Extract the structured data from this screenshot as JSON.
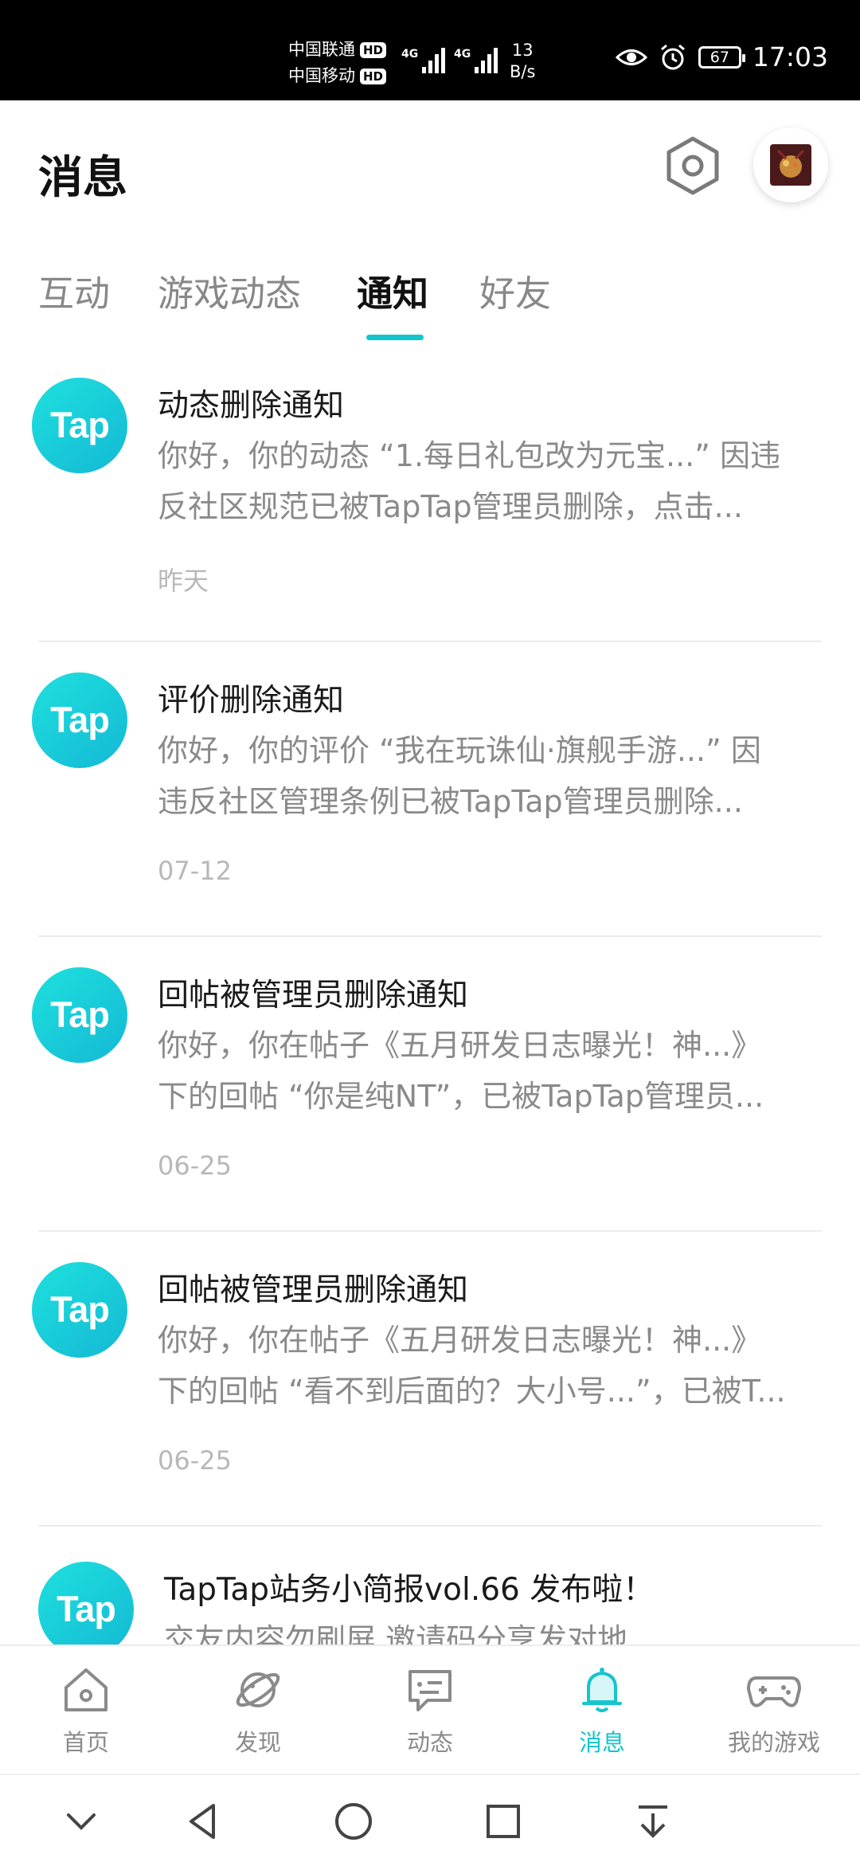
{
  "status_bar": {
    "carrier1": "中国联通",
    "carrier2": "中国移动",
    "hd": "HD",
    "net1": "4G",
    "net2": "4G",
    "speed_value": "13",
    "speed_unit": "B/s",
    "battery": "67",
    "time": "17:03"
  },
  "header": {
    "title": "消息",
    "settings_icon": "hexagon-settings-icon",
    "avatar_icon": "user-avatar"
  },
  "tabs": [
    {
      "label": "互动",
      "active": false
    },
    {
      "label": "游戏动态",
      "active": false
    },
    {
      "label": "通知",
      "active": true
    },
    {
      "label": "好友",
      "active": false
    }
  ],
  "notifications": [
    {
      "logo": "Tap",
      "title": "动态删除通知",
      "line1": "你好，你的动态 “1.每日礼包改为元宝...” 因违",
      "line2": "反社区规范已被TapTap管理员删除，点击...",
      "time": "昨天"
    },
    {
      "logo": "Tap",
      "title": "评价删除通知",
      "line1": "你好，你的评价 “我在玩诛仙·旗舰手游...” 因",
      "line2": "违反社区管理条例已被TapTap管理员删除...",
      "time": "07-12"
    },
    {
      "logo": "Tap",
      "title": "回帖被管理员删除通知",
      "line1": "你好，你在帖子《五月研发日志曝光！神...》",
      "line2": "下的回帖 “你是纯NT”，已被TapTap管理员...",
      "time": "06-25"
    },
    {
      "logo": "Tap",
      "title": "回帖被管理员删除通知",
      "line1": "你好，你在帖子《五月研发日志曝光！神...》",
      "line2": "下的回帖 “看不到后面的？大小号...”，已被T...",
      "time": "06-25"
    },
    {
      "logo": "Tap",
      "title": "TapTap站务小简报vol.66 发布啦！",
      "line1": "交友内容勿刷屏 邀请码分享发对地",
      "line2": "",
      "time": ""
    }
  ],
  "bottom_nav": [
    {
      "label": "首页",
      "icon": "home-icon",
      "active": false
    },
    {
      "label": "发现",
      "icon": "planet-icon",
      "active": false
    },
    {
      "label": "动态",
      "icon": "chat-bubble-icon",
      "active": false
    },
    {
      "label": "消息",
      "icon": "bell-icon",
      "active": true
    },
    {
      "label": "我的游戏",
      "icon": "gamepad-icon",
      "active": false
    }
  ],
  "colors": {
    "accent": "#15c5ce",
    "logo_gradient_start": "#1ee1de",
    "logo_gradient_end": "#14b8d4"
  }
}
